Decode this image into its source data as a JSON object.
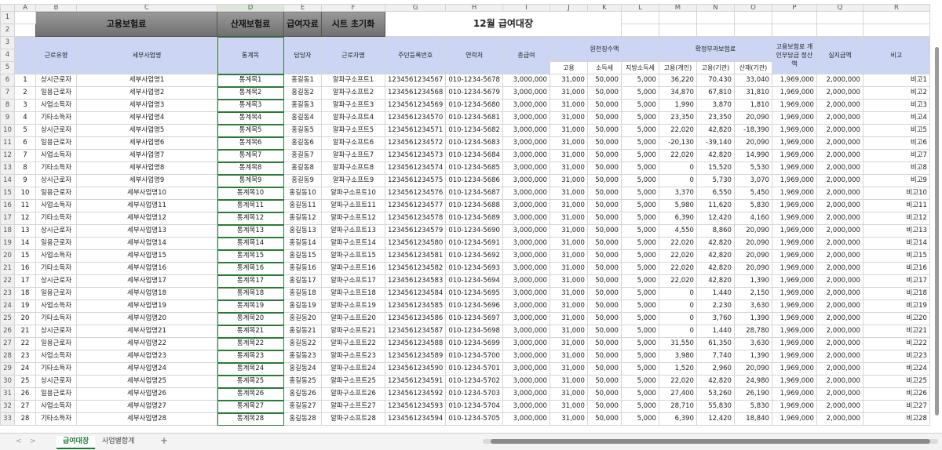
{
  "columns": [
    "A",
    "B",
    "C",
    "D",
    "E",
    "F",
    "G",
    "H",
    "I",
    "J",
    "K",
    "L",
    "M",
    "N",
    "O",
    "P",
    "Q",
    "R"
  ],
  "selected_column": "D",
  "buttons": {
    "employment": "고용보험료",
    "accident": "산재보험료",
    "payroll": "급여자료",
    "reset": "시트 초기화"
  },
  "sheet_title": "12월 급여대장",
  "headers": {
    "type": "근로유형",
    "site": "세부사업명",
    "account": "통계목",
    "manager": "담당자",
    "worker": "근로자명",
    "rrn": "주민등록번호",
    "contact": "연락처",
    "gross": "총급여",
    "withholding": "원천징수액",
    "wh_employment": "고용",
    "wh_income": "소득세",
    "wh_local": "지방소득세",
    "settlement": "확정부과보험료",
    "st_emp_personal": "고용(개인)",
    "st_emp_org": "고용(기관)",
    "st_accident": "산재(기관)",
    "personal_share": "고용보험료 개인부담금 정산액",
    "net_pay": "실지급액",
    "note": "비고"
  },
  "rows": [
    [
      "1",
      "상시근로자",
      "세부사업명1",
      "통계목1",
      "홍길동1",
      "알파구소프트1",
      "1234561234567",
      "010-1234-5678",
      "3,000,000",
      "31,000",
      "50,000",
      "5,000",
      "36,220",
      "70,430",
      "33,040",
      "1,969,000",
      "2,000,000",
      "비고1"
    ],
    [
      "2",
      "일용근로자",
      "세부사업명2",
      "통계목2",
      "홍길동2",
      "알파구소프트2",
      "1234561234568",
      "010-1234-5679",
      "3,000,000",
      "31,000",
      "50,000",
      "5,000",
      "34,870",
      "67,810",
      "31,810",
      "1,969,000",
      "2,000,000",
      "비고2"
    ],
    [
      "3",
      "사업소득자",
      "세부사업명3",
      "통계목3",
      "홍길동3",
      "알파구소프트3",
      "1234561234569",
      "010-1234-5680",
      "3,000,000",
      "31,000",
      "50,000",
      "5,000",
      "1,990",
      "3,870",
      "1,810",
      "1,969,000",
      "2,000,000",
      "비고3"
    ],
    [
      "4",
      "기타소득자",
      "세부사업명4",
      "통계목4",
      "홍길동4",
      "알파구소프트4",
      "1234561234570",
      "010-1234-5681",
      "3,000,000",
      "31,000",
      "50,000",
      "5,000",
      "23,350",
      "23,350",
      "20,090",
      "1,969,000",
      "2,000,000",
      "비고4"
    ],
    [
      "5",
      "상시근로자",
      "세부사업명5",
      "통계목5",
      "홍길동5",
      "알파구소프트5",
      "1234561234571",
      "010-1234-5682",
      "3,000,000",
      "31,000",
      "50,000",
      "5,000",
      "22,020",
      "42,820",
      "-18,390",
      "1,969,000",
      "2,000,000",
      "비고5"
    ],
    [
      "6",
      "일용근로자",
      "세부사업명6",
      "통계목6",
      "홍길동6",
      "알파구소프트6",
      "1234561234572",
      "010-1234-5683",
      "3,000,000",
      "31,000",
      "50,000",
      "5,000",
      "-20,130",
      "-39,140",
      "20,090",
      "1,969,000",
      "2,000,000",
      "비고6"
    ],
    [
      "7",
      "사업소득자",
      "세부사업명7",
      "통계목7",
      "홍길동7",
      "알파구소프트7",
      "1234561234573",
      "010-1234-5684",
      "3,000,000",
      "31,000",
      "50,000",
      "5,000",
      "22,020",
      "42,820",
      "14,990",
      "1,969,000",
      "2,000,000",
      "비고7"
    ],
    [
      "8",
      "기타소득자",
      "세부사업명8",
      "통계목8",
      "홍길동8",
      "알파구소프트8",
      "1234561234574",
      "010-1234-5685",
      "3,000,000",
      "31,000",
      "50,000",
      "5,000",
      "0",
      "15,520",
      "5,530",
      "1,969,000",
      "2,000,000",
      "비고8"
    ],
    [
      "9",
      "상시근로자",
      "세부사업명9",
      "통계목9",
      "홍길동9",
      "알파구소프트9",
      "1234561234575",
      "010-1234-5686",
      "3,000,000",
      "31,000",
      "50,000",
      "5,000",
      "0",
      "5,730",
      "3,070",
      "1,969,000",
      "2,000,000",
      "비고9"
    ],
    [
      "10",
      "일용근로자",
      "세부사업명10",
      "통계목10",
      "홍길동10",
      "알파구소프트10",
      "1234561234576",
      "010-1234-5687",
      "3,000,000",
      "31,000",
      "50,000",
      "5,000",
      "3,370",
      "6,550",
      "5,450",
      "1,969,000",
      "2,000,000",
      "비고10"
    ],
    [
      "11",
      "사업소득자",
      "세부사업명11",
      "통계목11",
      "홍길동11",
      "알파구소프트11",
      "1234561234577",
      "010-1234-5688",
      "3,000,000",
      "31,000",
      "50,000",
      "5,000",
      "5,980",
      "11,620",
      "5,830",
      "1,969,000",
      "2,000,000",
      "비고11"
    ],
    [
      "12",
      "기타소득자",
      "세부사업명12",
      "통계목12",
      "홍길동12",
      "알파구소프트12",
      "1234561234578",
      "010-1234-5689",
      "3,000,000",
      "31,000",
      "50,000",
      "5,000",
      "6,390",
      "12,420",
      "4,160",
      "1,969,000",
      "2,000,000",
      "비고12"
    ],
    [
      "13",
      "상시근로자",
      "세부사업명13",
      "통계목13",
      "홍길동13",
      "알파구소프트13",
      "1234561234579",
      "010-1234-5690",
      "3,000,000",
      "31,000",
      "50,000",
      "5,000",
      "4,550",
      "8,860",
      "20,090",
      "1,969,000",
      "2,000,000",
      "비고13"
    ],
    [
      "14",
      "일용근로자",
      "세부사업명14",
      "통계목14",
      "홍길동14",
      "알파구소프트14",
      "1234561234580",
      "010-1234-5691",
      "3,000,000",
      "31,000",
      "50,000",
      "5,000",
      "22,020",
      "42,820",
      "20,090",
      "1,969,000",
      "2,000,000",
      "비고14"
    ],
    [
      "15",
      "사업소득자",
      "세부사업명15",
      "통계목15",
      "홍길동15",
      "알파구소프트15",
      "1234561234581",
      "010-1234-5692",
      "3,000,000",
      "31,000",
      "50,000",
      "5,000",
      "22,020",
      "42,820",
      "20,090",
      "1,969,000",
      "2,000,000",
      "비고15"
    ],
    [
      "16",
      "기타소득자",
      "세부사업명16",
      "통계목16",
      "홍길동16",
      "알파구소프트16",
      "1234561234582",
      "010-1234-5693",
      "3,000,000",
      "31,000",
      "50,000",
      "5,000",
      "22,020",
      "42,820",
      "20,090",
      "1,969,000",
      "2,000,000",
      "비고16"
    ],
    [
      "17",
      "상시근로자",
      "세부사업명17",
      "통계목17",
      "홍길동17",
      "알파구소프트17",
      "1234561234583",
      "010-1234-5694",
      "3,000,000",
      "31,000",
      "50,000",
      "5,000",
      "22,020",
      "42,820",
      "1,390",
      "1,969,000",
      "2,000,000",
      "비고17"
    ],
    [
      "18",
      "일용근로자",
      "세부사업명18",
      "통계목18",
      "홍길동18",
      "알파구소프트18",
      "1234561234584",
      "010-1234-5695",
      "3,000,000",
      "31,000",
      "50,000",
      "5,000",
      "0",
      "1,440",
      "2,150",
      "1,969,000",
      "2,000,000",
      "비고18"
    ],
    [
      "19",
      "사업소득자",
      "세부사업명19",
      "통계목19",
      "홍길동19",
      "알파구소프트19",
      "1234561234585",
      "010-1234-5696",
      "3,000,000",
      "31,000",
      "50,000",
      "5,000",
      "0",
      "2,230",
      "3,630",
      "1,969,000",
      "2,000,000",
      "비고19"
    ],
    [
      "20",
      "기타소득자",
      "세부사업명20",
      "통계목20",
      "홍길동20",
      "알파구소프트20",
      "1234561234586",
      "010-1234-5697",
      "3,000,000",
      "31,000",
      "50,000",
      "5,000",
      "0",
      "3,760",
      "1,390",
      "1,969,000",
      "2,000,000",
      "비고20"
    ],
    [
      "21",
      "상시근로자",
      "세부사업명21",
      "통계목21",
      "홍길동21",
      "알파구소프트21",
      "1234561234587",
      "010-1234-5698",
      "3,000,000",
      "31,000",
      "50,000",
      "5,000",
      "0",
      "1,440",
      "28,780",
      "1,969,000",
      "2,000,000",
      "비고21"
    ],
    [
      "22",
      "일용근로자",
      "세부사업명22",
      "통계목22",
      "홍길동22",
      "알파구소프트22",
      "1234561234588",
      "010-1234-5699",
      "3,000,000",
      "31,000",
      "50,000",
      "5,000",
      "31,550",
      "61,350",
      "3,630",
      "1,969,000",
      "2,000,000",
      "비고22"
    ],
    [
      "23",
      "사업소득자",
      "세부사업명23",
      "통계목23",
      "홍길동23",
      "알파구소프트23",
      "1234561234589",
      "010-1234-5700",
      "3,000,000",
      "31,000",
      "50,000",
      "5,000",
      "3,980",
      "7,740",
      "1,390",
      "1,969,000",
      "2,000,000",
      "비고23"
    ],
    [
      "24",
      "기타소득자",
      "세부사업명24",
      "통계목24",
      "홍길동24",
      "알파구소프트24",
      "1234561234590",
      "010-1234-5701",
      "3,000,000",
      "31,000",
      "50,000",
      "5,000",
      "1,520",
      "2,960",
      "20,090",
      "1,969,000",
      "2,000,000",
      "비고24"
    ],
    [
      "25",
      "상시근로자",
      "세부사업명25",
      "통계목25",
      "홍길동25",
      "알파구소프트25",
      "1234561234591",
      "010-1234-5702",
      "3,000,000",
      "31,000",
      "50,000",
      "5,000",
      "22,020",
      "42,820",
      "24,980",
      "1,969,000",
      "2,000,000",
      "비고25"
    ],
    [
      "26",
      "일용근로자",
      "세부사업명26",
      "통계목26",
      "홍길동26",
      "알파구소프트26",
      "1234561234592",
      "010-1234-5703",
      "3,000,000",
      "31,000",
      "50,000",
      "5,000",
      "27,400",
      "53,260",
      "26,190",
      "1,969,000",
      "2,000,000",
      "비고26"
    ],
    [
      "27",
      "사업소득자",
      "세부사업명27",
      "통계목27",
      "홍길동27",
      "알파구소프트27",
      "1234561234593",
      "010-1234-5704",
      "3,000,000",
      "31,000",
      "50,000",
      "5,000",
      "28,710",
      "55,830",
      "5,830",
      "1,969,000",
      "2,000,000",
      "비고27"
    ],
    [
      "28",
      "기타소득자",
      "세부사업명28",
      "통계목28",
      "홍길동28",
      "알파구소프트28",
      "1234561234594",
      "010-1234-5705",
      "3,000,000",
      "31,000",
      "50,000",
      "5,000",
      "6,390",
      "12,420",
      "18,840",
      "1,969,000",
      "2,000,000",
      "비고28"
    ]
  ],
  "sheet_tabs": [
    "급여대장",
    "사업별합계"
  ],
  "active_tab": "급여대장",
  "add_sheet": "+",
  "nav_prev": "<",
  "nav_next": ">"
}
